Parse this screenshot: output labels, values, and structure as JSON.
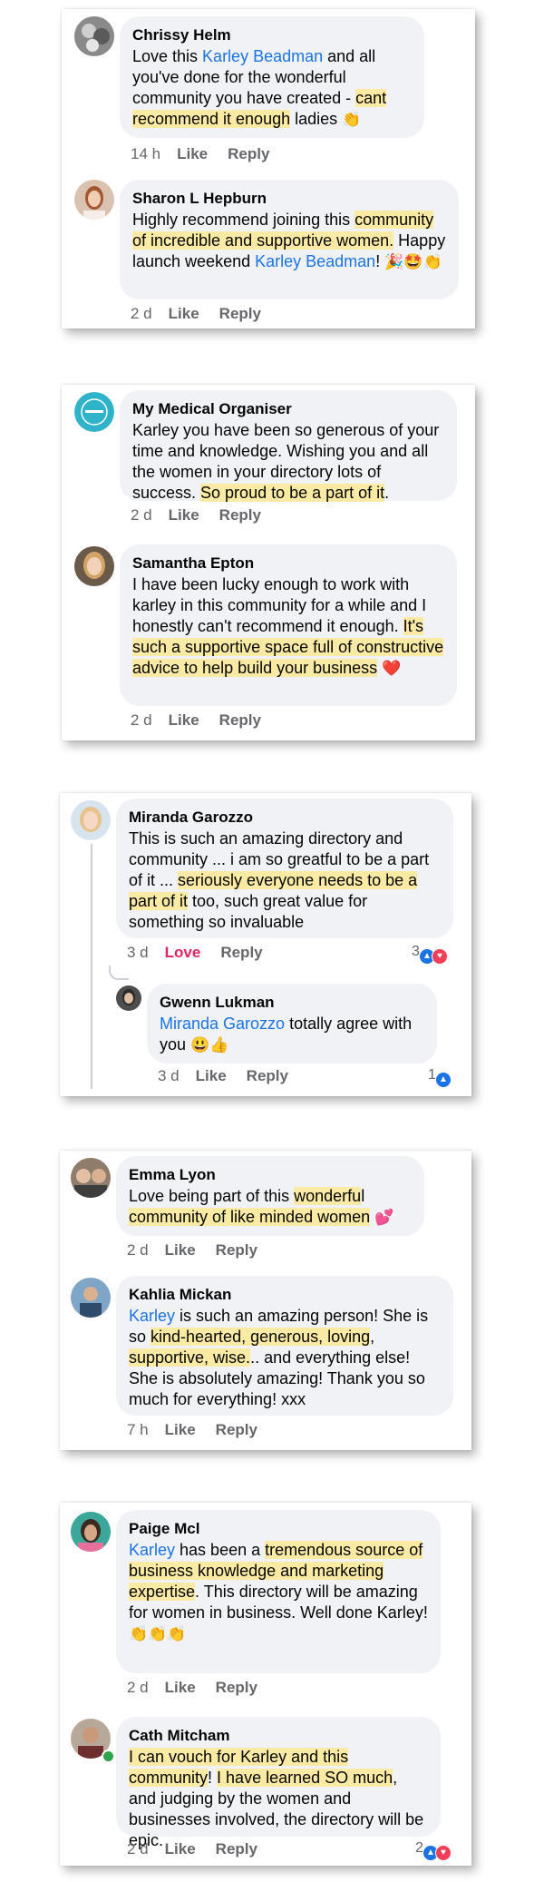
{
  "comments": {
    "c1": {
      "name": "Chrissy Helm",
      "t1": "Love this ",
      "tag": "Karley Beadman",
      "t2": " and all you've done for the wonderful community you have created - ",
      "hl": "cant recommend it enough",
      "t3": " ladies ",
      "emoji": "👏",
      "time": "14 h",
      "like": "Like",
      "reply": "Reply"
    },
    "c2": {
      "name": "Sharon L Hepburn",
      "t1": "Highly recommend joining this ",
      "hl": "community of incredible and supportive women.",
      "t2": " Happy launch weekend ",
      "tag": "Karley Beadman",
      "t3": "! ",
      "emoji": "🎉🤩👏",
      "time": "2 d",
      "like": "Like",
      "reply": "Reply"
    },
    "c3": {
      "name": "My Medical Organiser",
      "t1": "Karley you have been so generous of your time and knowledge.  Wishing you and all the women in your directory lots of success. ",
      "hl": "So proud to be a part of it",
      "t2": ".",
      "time": "2 d",
      "like": "Like",
      "reply": "Reply"
    },
    "c4": {
      "name": "Samantha Epton",
      "t1": "I have been lucky enough to work with karley in this community for a while and I honestly can't recommend it enough. ",
      "hl": "It's such a supportive space full of constructive advice to help build your business",
      "t2": " ",
      "emoji": "❤️",
      "time": "2 d",
      "like": "Like",
      "reply": "Reply"
    },
    "c5": {
      "name": "Miranda Garozzo",
      "t1": "This is such an amazing directory and community ... i am so greatful to be a part of it ... ",
      "hl": "seriously everyone needs to be a part of it",
      "t2": " too, such great value for something so invaluable",
      "time": "3 d",
      "like": "Love",
      "reply": "Reply",
      "reactions": "3"
    },
    "c6": {
      "name": "Gwenn Lukman",
      "tag": "Miranda Garozzo",
      "t1": " totally agree with you ",
      "emoji": "😃👍",
      "time": "3 d",
      "like": "Like",
      "reply": "Reply",
      "reactions": "1"
    },
    "c7": {
      "name": "Emma Lyon",
      "t1": "Love being part of this ",
      "hl1": "wonderfu",
      "t2": "l ",
      "hl2": "community of like minded women",
      "t3": " ",
      "emoji": "💕",
      "time": "2 d",
      "like": "Like",
      "reply": "Reply"
    },
    "c8": {
      "name": "Kahlia Mickan",
      "tag": "Karley",
      "t1": " is such an amazing person! She is so ",
      "hl1": "kind-hearted, generous, loving",
      "t2": ", ",
      "hl2": "supportive, wise.",
      "t3": ".. and everything else! She is absolutely amazing! Thank you so much for everything! xxx",
      "time": "7 h",
      "like": "Like",
      "reply": "Reply"
    },
    "c9": {
      "name": "Paige Mcl",
      "tag": "Karley",
      "t1": " has been a ",
      "hl": "tremendous source of business knowledge and marketing expertise",
      "t2": ". This directory will be amazing for women in business. Well done Karley! ",
      "emoji": "👏👏👏",
      "time": "2 d",
      "like": "Like",
      "reply": "Reply"
    },
    "c10": {
      "name": "Cath Mitcham",
      "hl1": "I can vouch for Karley and this community",
      "t1": "! ",
      "hl2": "I have learned SO much",
      "t2": ", and judging by the women and businesses involved, the directory will be epic.",
      "time": "2 d",
      "like": "Like",
      "reply": "Reply",
      "reactions": "2"
    }
  },
  "icons": {
    "like": "thumbs-up-icon",
    "love": "heart-icon"
  },
  "colors": {
    "highlight": "#fbeaa3",
    "tag": "#1b74e4",
    "bubble": "#f0f2f5",
    "love": "#e0245e"
  }
}
